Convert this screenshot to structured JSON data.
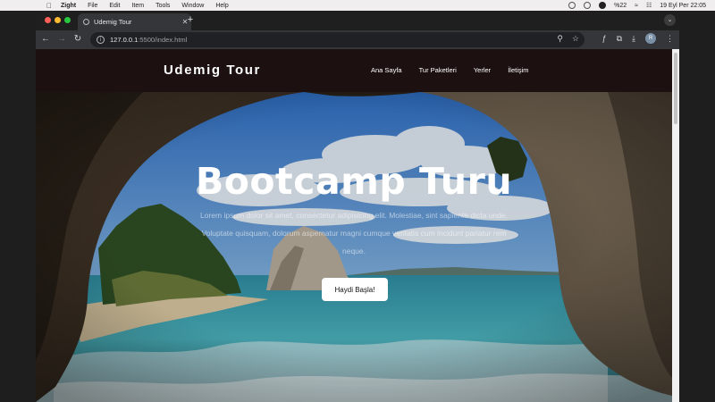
{
  "os_menubar": {
    "app": "Zight",
    "items": [
      "File",
      "Edit",
      "Item",
      "Tools",
      "Window",
      "Help"
    ],
    "battery": "%22",
    "datetime": "19 Eyl Per  22:05"
  },
  "browser": {
    "tab_title": "Udemig Tour",
    "url_host": "127.0.0.1",
    "url_path": ":5500/index.html",
    "profile_initial": "R"
  },
  "site": {
    "brand": "Udemig Tour",
    "nav": [
      "Ana Sayfa",
      "Tur Paketleri",
      "Yerler",
      "İletişim"
    ],
    "hero_title": "Bootcamp Turu",
    "hero_text": "Lorem ipsum dolor sit amet, consectetur adipisicing elit. Molestiae, sint sapiente dicta unde. Voluptate quisquam, dolorum aspernatur magni cumque veritatis cum incidunt pariatur rem neque.",
    "cta_label": "Haydi Başla!"
  },
  "colors": {
    "nav_bg": "#1c1110",
    "sky": "#3d7ec8",
    "sea": "#3fa7b8"
  }
}
